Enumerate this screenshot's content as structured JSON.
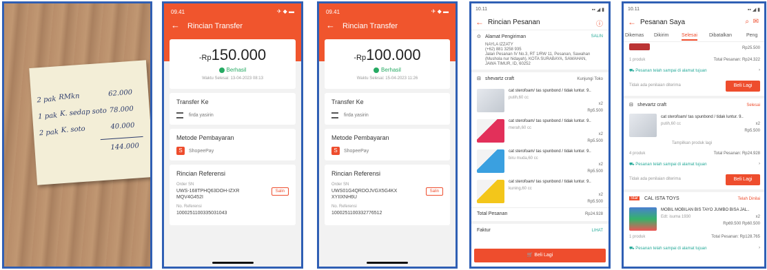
{
  "photo": {
    "note_lines": [
      {
        "qty": "2 pak",
        "item": "RMkn",
        "price": "62.000"
      },
      {
        "qty": "1 pak",
        "item": "K. sedap soto",
        "price": "78.000"
      },
      {
        "qty": "2 pak",
        "item": "K. soto",
        "price": "40.000"
      }
    ],
    "total": "144.000"
  },
  "transfer1": {
    "status_time": "09.41",
    "title": "Rincian Transfer",
    "amount_prefix": "-Rp",
    "amount": "150.000",
    "status": "Berhasil",
    "date": "Waktu Selesai: 13-04-2023 08:13",
    "transfer_to_label": "Transfer Ke",
    "recipient": "firda yasirin",
    "method_label": "Metode Pembayaran",
    "method": "ShopeePay",
    "ref_label": "Rincian Referensi",
    "order_sn_label": "Order SN",
    "order_sn": "UWS-168TPHQ63DOH-IZXR MQV4G452I",
    "salin": "Salin",
    "ref_no_label": "No. Referensi",
    "ref_no": "1000251100335031043"
  },
  "transfer2": {
    "status_time": "09.41",
    "title": "Rincian Transfer",
    "amount_prefix": "-Rp",
    "amount": "100.000",
    "status": "Berhasil",
    "date": "Waktu Selesai: 15-04-2023 11:26",
    "transfer_to_label": "Transfer Ke",
    "recipient": "firda yasirin",
    "method_label": "Metode Pembayaran",
    "method": "ShopeePay",
    "ref_label": "Rincian Referensi",
    "order_sn_label": "Order SN",
    "order_sn": "UWS01G4QRDOJVGX5G4KX XYIIXNH6U",
    "salin": "Salin",
    "ref_no_label": "No. Referensi",
    "ref_no": "1000251100332776512"
  },
  "order": {
    "status_time": "10.11",
    "title": "Rincian Pesanan",
    "address_label": "Alamat Pengiriman",
    "salin": "SALIN",
    "address_lines": [
      "NAYLA IZZATY",
      "(+62) 881 3258 935",
      "Jalan Pesanan IV No.3, RT 1/RW 11, Pesanan, Sawahan",
      "(Mushola nur hidayah), KOTA SURABAYA, SAWAHAN,",
      "JAWA TIMUR, ID, 60252"
    ],
    "shop": "shevartz craft",
    "visit_shop": "Kunjungi Toko",
    "items": [
      {
        "name": "cat sterofoam/ tas spunbond / tidak luntur. 9..",
        "variant": "putih,60 cc",
        "qty": "x2",
        "price": "Rp5.500",
        "color": "#d8dde4"
      },
      {
        "name": "cat sterofoam/ tas spunbond / tidak luntur. 9..",
        "variant": "merah,60 cc",
        "qty": "x2",
        "price": "Rp5.500",
        "color": "#e2305a"
      },
      {
        "name": "cat sterofoam/ tas spunbond / tidak luntur. 9..",
        "variant": "biru muda,60 cc",
        "qty": "x2",
        "price": "Rp5.500",
        "color": "#3aa0e0"
      },
      {
        "name": "cat sterofoam/ tas spunbond / tidak luntur. 9..",
        "variant": "kuning,60 cc",
        "qty": "x2",
        "price": "Rp5.500",
        "color": "#f3c61a"
      }
    ],
    "total_label": "Total Pesanan",
    "total": "Rp24.928",
    "invoice_label": "Faktur",
    "invoice_action": "LIHAT",
    "buy_again": "Beli Lagi"
  },
  "myorders": {
    "status_time": "10.11",
    "title": "Pesanan Saya",
    "tabs": [
      "Dikemas",
      "Dikirim",
      "Selesai",
      "Dibatalkan",
      "Peng"
    ],
    "active_tab": 2,
    "top_price": "Rp25.500",
    "top_count": "1 produk",
    "top_total": "Total Pesanan: Rp24.322",
    "delivered_msg": "Pesanan telah sampai di alamat tujuan",
    "no_rating": "Tidak ada penilaian diterima",
    "buy_again": "Beli Lagi",
    "shop2": "shevartz craft",
    "shop2_status": "Selesai",
    "shop2_item": "cat sterofoam/ tas spunbond / tidak luntur. 9..",
    "shop2_variant": "putih,60 cc",
    "shop2_qty": "x2",
    "shop2_price": "Rp5.500",
    "more_products": "Tampilkan produk lagi",
    "shop2_count": "4 produk",
    "shop2_total": "Total Pesanan: Rp24.928",
    "shop3_badge": "Star",
    "shop3": "CAL ISTA TOYS",
    "shop3_status": "Telah Dinilai",
    "shop3_item": "MOBIL MOBILAN BIS TAYO JUMBO BISA JAL..",
    "shop3_variant": "Edt: isuma 1930",
    "shop3_qty": "x2",
    "shop3_price": "Rp69.500 Rp60.500",
    "shop3_count": "1 produk",
    "shop3_total": "Total Pesanan: Rp128.765",
    "colors": {
      "accent": "#ee4d2d",
      "teal": "#26aa99",
      "success": "#26aa63",
      "frame": "#2f5fb4"
    }
  }
}
